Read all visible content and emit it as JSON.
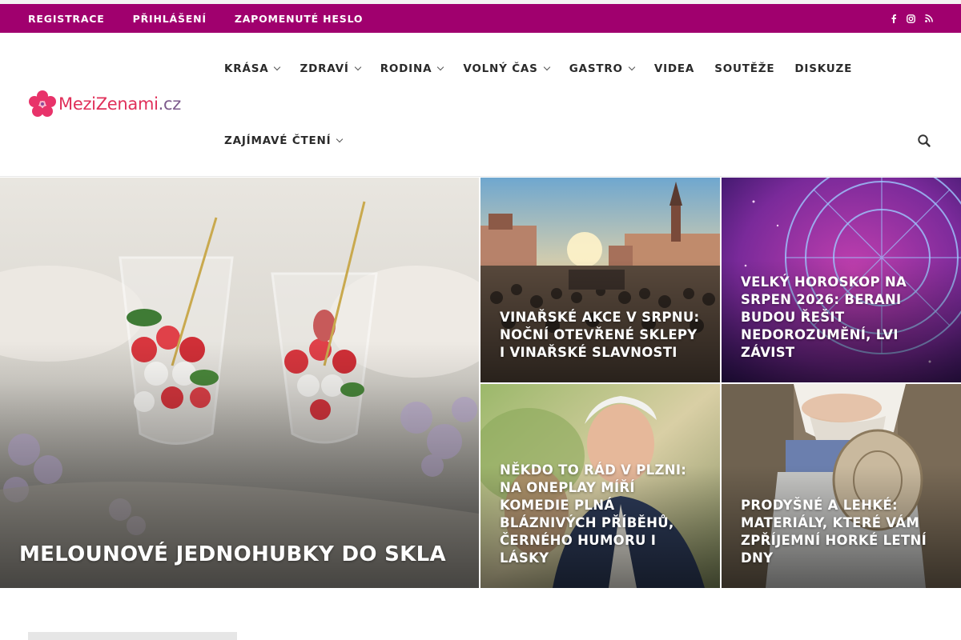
{
  "topbar": {
    "links": [
      "REGISTRACE",
      "PŘIHLÁŠENÍ",
      "ZAPOMENUTÉ HESLO"
    ],
    "social_icons": [
      "facebook-icon",
      "instagram-icon",
      "rss-icon"
    ]
  },
  "logo": {
    "part1": "MeziZenami",
    "part2": ".cz"
  },
  "nav": {
    "row1": [
      {
        "label": "KRÁSA",
        "dropdown": true
      },
      {
        "label": "ZDRAVÍ",
        "dropdown": true
      },
      {
        "label": "RODINA",
        "dropdown": true
      },
      {
        "label": "VOLNÝ ČAS",
        "dropdown": true
      },
      {
        "label": "GASTRO",
        "dropdown": true
      },
      {
        "label": "VIDEA",
        "dropdown": false
      },
      {
        "label": "SOUTĚŽE",
        "dropdown": false
      },
      {
        "label": "DISKUZE",
        "dropdown": false
      }
    ],
    "row2": [
      {
        "label": "ZAJÍMAVÉ ČTENÍ",
        "dropdown": true
      }
    ]
  },
  "featured": [
    {
      "title": "MELOUNOVÉ JEDNOHUBKY DO SKLA"
    },
    {
      "title": "VINAŘSKÉ AKCE V SRPNU: NOČNÍ OTEVŘENÉ SKLEPY I VINAŘSKÉ SLAVNOSTI"
    },
    {
      "title": "VELKÝ HOROSKOP NA SRPEN 2026: BERANI BUDOU ŘEŠIT NEDOROZUMĚNÍ, LVI ZÁVIST"
    },
    {
      "title": "NĚKDO TO RÁD V PLZNI: NA ONEPLAY MÍŘÍ KOMEDIE PLNÁ BLÁZNIVÝCH PŘÍBĚHŮ, ČERNÉHO HUMORU I LÁSKY"
    },
    {
      "title": "PRODYŠNÉ A LEHKÉ: MATERIÁLY, KTERÉ VÁM ZPŘÍJEMNÍ HORKÉ LETNÍ DNY"
    }
  ],
  "colors": {
    "brand": "#a0006e",
    "logo_pink": "#e0305a"
  }
}
